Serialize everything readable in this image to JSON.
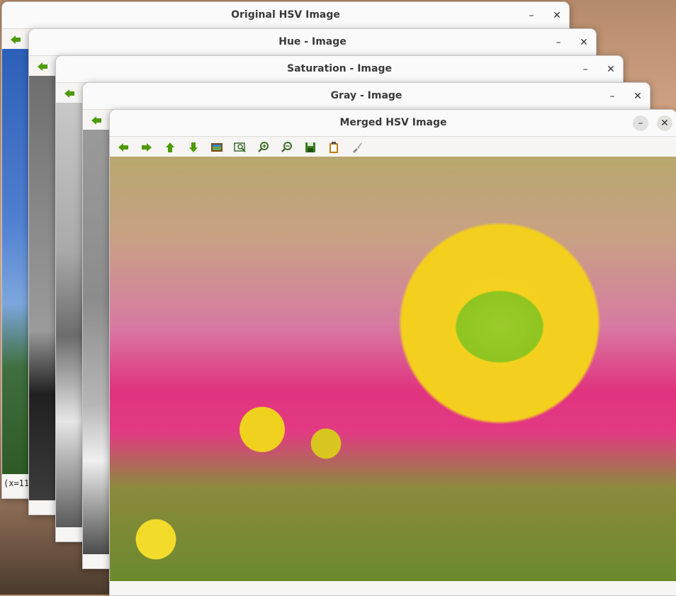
{
  "windows": {
    "original": {
      "title": "Original HSV Image",
      "status": "(x=11"
    },
    "hue": {
      "title": "Hue - Image"
    },
    "saturation": {
      "title": "Saturation - Image"
    },
    "gray": {
      "title": "Gray - Image"
    },
    "merged": {
      "title": "Merged HSV Image"
    }
  },
  "window_controls": {
    "minimize": "–",
    "close": "✕"
  },
  "toolbar_icons": [
    "arrow-left-icon",
    "arrow-right-icon",
    "arrow-up-icon",
    "arrow-down-icon",
    "image-icon",
    "zoom-fit-icon",
    "zoom-in-icon",
    "zoom-out-icon",
    "save-icon",
    "clipboard-icon",
    "brush-icon"
  ],
  "colors": {
    "icon_green": "#4e9a06",
    "accent_pink": "#e23a83",
    "sunflower_yellow": "#f3cf1e"
  }
}
